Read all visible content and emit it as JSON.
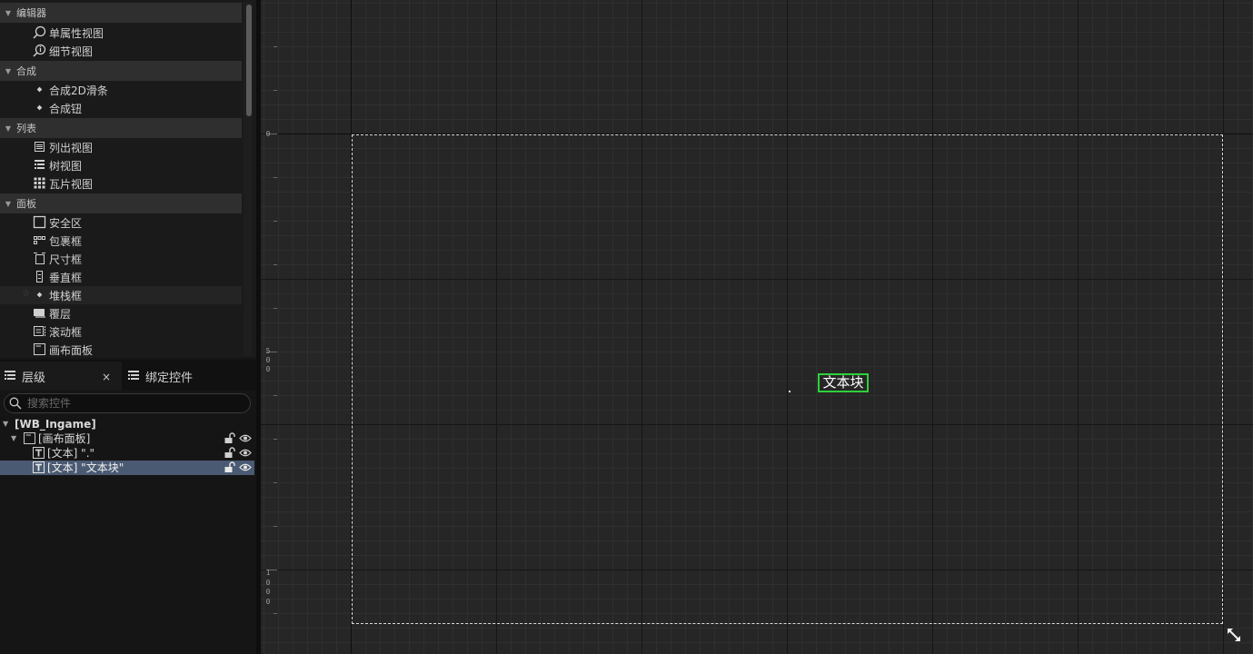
{
  "palette": {
    "categories": [
      {
        "label": "编辑器",
        "items": [
          {
            "label": "单属性视图",
            "icon": "magnifier-icon"
          },
          {
            "label": "细节视图",
            "icon": "info-icon"
          }
        ]
      },
      {
        "label": "合成",
        "items": [
          {
            "label": "合成2D滑条",
            "icon": "diamond-bullet-icon"
          },
          {
            "label": "合成钮",
            "icon": "diamond-bullet-icon"
          }
        ]
      },
      {
        "label": "列表",
        "items": [
          {
            "label": "列出视图",
            "icon": "list-view-icon"
          },
          {
            "label": "树视图",
            "icon": "tree-view-icon"
          },
          {
            "label": "瓦片视图",
            "icon": "tile-view-icon"
          }
        ]
      },
      {
        "label": "面板",
        "items": [
          {
            "label": "安全区",
            "icon": "safe-zone-icon"
          },
          {
            "label": "包裹框",
            "icon": "wrap-box-icon"
          },
          {
            "label": "尺寸框",
            "icon": "size-box-icon"
          },
          {
            "label": "垂直框",
            "icon": "vertical-box-icon"
          },
          {
            "label": "堆栈框",
            "icon": "diamond-bullet-icon"
          },
          {
            "label": "覆层",
            "icon": "overlay-icon"
          },
          {
            "label": "滚动框",
            "icon": "scroll-box-icon"
          },
          {
            "label": "画布面板",
            "icon": "canvas-panel-icon"
          }
        ]
      }
    ]
  },
  "hierarchy": {
    "tabs": [
      {
        "label": "层级",
        "icon": "hierarchy-icon"
      },
      {
        "label": "绑定控件",
        "icon": "bind-widgets-icon"
      }
    ],
    "close_glyph": "×",
    "search_placeholder": "搜索控件",
    "tree": [
      {
        "label": "[WB_Ingame]",
        "bold": true
      },
      {
        "label": "[画布面板]",
        "icon": "canvas-panel-icon"
      },
      {
        "label": "[文本] \".\"",
        "icon": "text-widget-icon"
      },
      {
        "label": "[文本] \"文本块\"",
        "icon": "text-widget-icon",
        "selected": true
      }
    ]
  },
  "designer": {
    "ruler_labels": [
      {
        "text": "0"
      },
      {
        "text": "5\n0\n0"
      },
      {
        "text": "1\n0\n0\n0"
      }
    ],
    "text_block": "文本块",
    "selection_color": "#2ed13a"
  }
}
